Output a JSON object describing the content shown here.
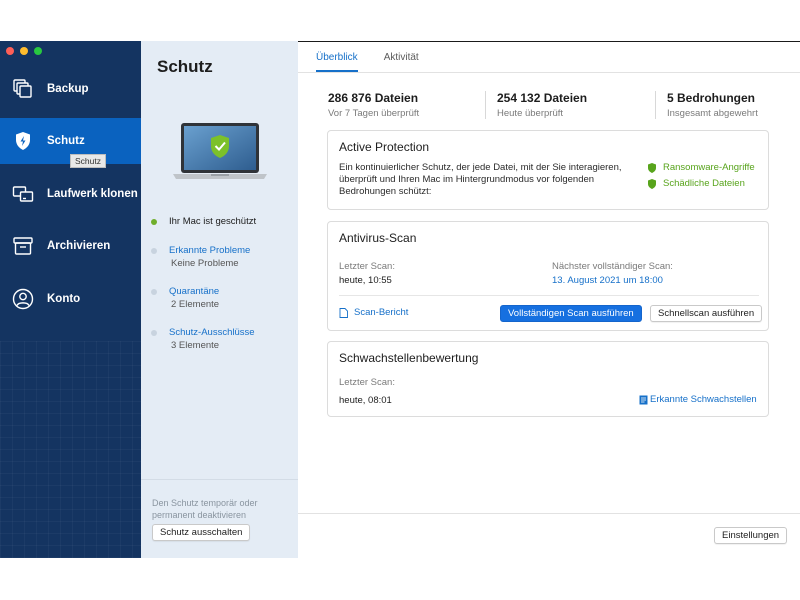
{
  "sidebar": {
    "items": [
      {
        "label": "Backup",
        "icon": "backup-icon"
      },
      {
        "label": "Schutz",
        "icon": "shield-lightning-icon"
      },
      {
        "label": "Laufwerk klonen",
        "icon": "clone-drive-icon"
      },
      {
        "label": "Archivieren",
        "icon": "archive-icon"
      },
      {
        "label": "Konto",
        "icon": "account-icon"
      }
    ],
    "tooltip": "Schutz",
    "colors": {
      "background": "#143461",
      "active": "#0a62bf"
    }
  },
  "middle": {
    "title": "Schutz",
    "status_items": [
      {
        "label": "Ihr Mac ist geschützt",
        "sub": ""
      },
      {
        "label": "Erkannte Probleme",
        "sub": "Keine Probleme"
      },
      {
        "label": "Quarantäne",
        "sub": "2 Elemente"
      },
      {
        "label": "Schutz-Ausschlüsse",
        "sub": "3 Elemente"
      }
    ],
    "footer_text": "Den Schutz temporär oder permanent deaktivieren",
    "disable_button": "Schutz ausschalten"
  },
  "main": {
    "tabs": [
      {
        "label": "Überblick",
        "active": true
      },
      {
        "label": "Aktivität",
        "active": false
      }
    ],
    "stats": [
      {
        "value": "286 876 Dateien",
        "label": "Vor 7 Tagen überprüft"
      },
      {
        "value": "254 132 Dateien",
        "label": "Heute überprüft"
      },
      {
        "value": "5 Bedrohungen",
        "label": "Insgesamt abgewehrt"
      }
    ],
    "active_protection": {
      "title": "Active Protection",
      "description": "Ein kontinuierlicher Schutz, der jede Datei, mit der Sie interagieren, überprüft und Ihren Mac im Hintergrundmodus vor folgenden Bedrohungen schützt:",
      "threats": [
        "Ransomware-Angriffe",
        "Schädliche Dateien"
      ],
      "threat_color": "#58a41c"
    },
    "antivirus": {
      "title": "Antivirus-Scan",
      "last_scan_label": "Letzter Scan:",
      "last_scan_value": "heute, 10:55",
      "next_scan_label": "Nächster vollständiger Scan:",
      "next_scan_value": "13. August 2021 um 18:00",
      "report_link": "Scan-Bericht",
      "full_scan_button": "Vollständigen Scan ausführen",
      "quick_scan_button": "Schnellscan ausführen"
    },
    "vulnerability": {
      "title": "Schwachstellenbewertung",
      "last_scan_label": "Letzter Scan:",
      "last_scan_value": "heute, 08:01",
      "link": "Erkannte Schwachstellen"
    },
    "settings_button": "Einstellungen",
    "accent_color": "#1670c9"
  }
}
